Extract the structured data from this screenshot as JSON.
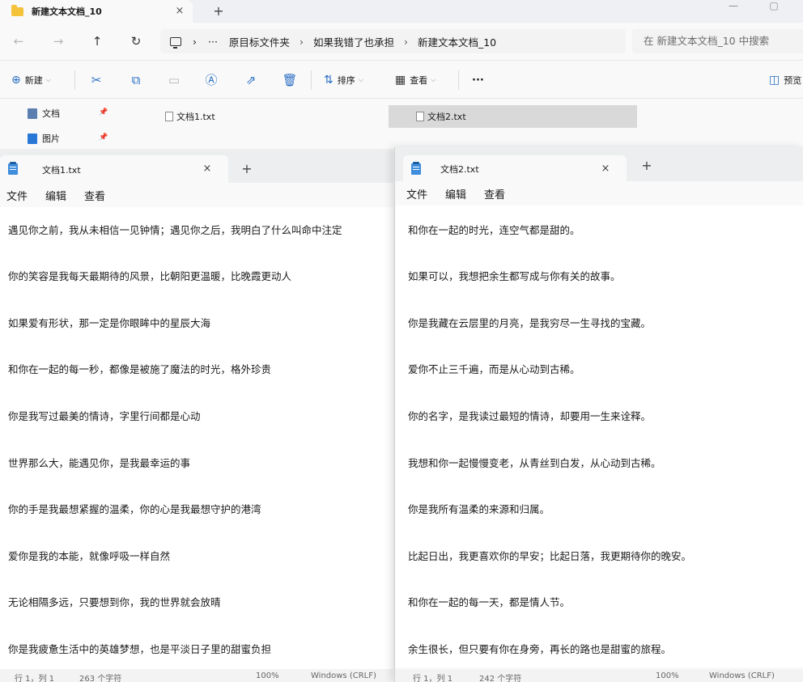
{
  "explorer": {
    "tab_title": "新建文本文档_10",
    "tab_close": "×",
    "tab_add": "+",
    "window_min": "—",
    "window_max": "▢",
    "nav": {
      "back": "←",
      "forward": "→",
      "up": "↑",
      "refresh": "↻"
    },
    "breadcrumb": {
      "ellipsis": "···",
      "items": [
        "原目标文件夹",
        "如果我错了也承担",
        "新建文本文档_10"
      ],
      "separator": "›"
    },
    "search_placeholder": "在 新建文本文档_10 中搜索",
    "commands": {
      "new": "新建",
      "sort": "排序",
      "view": "查看",
      "more": "···",
      "preview": "预览"
    },
    "quick_access": [
      {
        "label": "文档",
        "icon": "document-icon"
      },
      {
        "label": "图片",
        "icon": "pictures-icon"
      }
    ],
    "files": [
      {
        "name": "文档1.txt",
        "selected": false
      },
      {
        "name": "文档2.txt",
        "selected": true
      }
    ]
  },
  "notepad1": {
    "tab_title": "文档1.txt",
    "close": "×",
    "add": "+",
    "menu": [
      "文件",
      "编辑",
      "查看"
    ],
    "lines": [
      "遇见你之前，我从未相信一见钟情；遇见你之后，我明白了什么叫命中注定",
      "你的笑容是我每天最期待的风景，比朝阳更温暖，比晚霞更动人",
      "如果爱有形状，那一定是你眼眸中的星辰大海",
      "和你在一起的每一秒，都像是被施了魔法的时光，格外珍贵",
      "你是我写过最美的情诗，字里行间都是心动",
      "世界那么大，能遇见你，是我最幸运的事",
      "你的手是我最想紧握的温柔，你的心是我最想守护的港湾",
      "爱你是我的本能，就像呼吸一样自然",
      "无论相隔多远，只要想到你，我的世界就会放晴",
      "你是我疲惫生活中的英雄梦想，也是平淡日子里的甜蜜负担"
    ],
    "status": {
      "position": "行 1，列 1",
      "chars": "263 个字符",
      "zoom": "100%",
      "eol": "Windows (CRLF)"
    }
  },
  "notepad2": {
    "tab_title": "文档2.txt",
    "close": "×",
    "add": "+",
    "menu": [
      "文件",
      "编辑",
      "查看"
    ],
    "lines": [
      "和你在一起的时光，连空气都是甜的。",
      "如果可以，我想把余生都写成与你有关的故事。",
      "你是我藏在云层里的月亮，是我穷尽一生寻找的宝藏。",
      "爱你不止三千遍，而是从心动到古稀。",
      "你的名字，是我读过最短的情诗，却要用一生来诠释。",
      "我想和你一起慢慢变老，从青丝到白发，从心动到古稀。",
      "你是我所有温柔的来源和归属。",
      "比起日出，我更喜欢你的早安；比起日落，我更期待你的晚安。",
      "和你在一起的每一天，都是情人节。",
      "余生很长，但只要有你在身旁，再长的路也是甜蜜的旅程。"
    ],
    "status": {
      "position": "行 1，列 1",
      "chars": "242 个字符",
      "zoom": "100%",
      "eol": "Windows (CRLF)"
    }
  }
}
